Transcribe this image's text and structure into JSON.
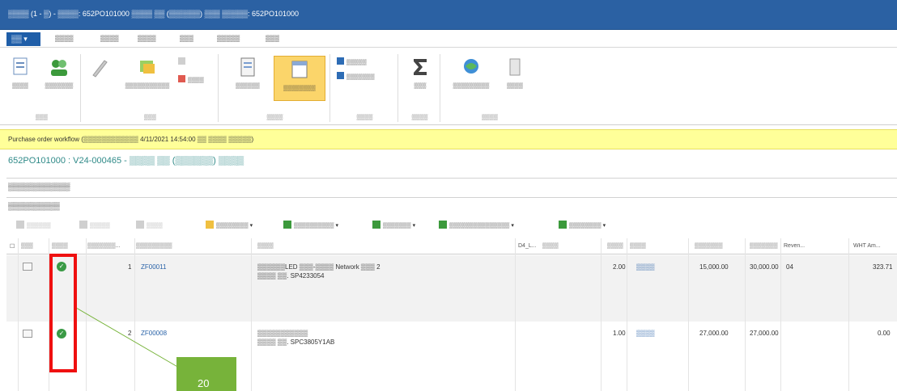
{
  "window": {
    "title": "▒▒▒▒ (1 - ▒) - ▒▒▒▒: 652PO101000 ▒▒▒▒ ▒▒ (▒▒▒▒▒▒) ▒▒▒ ▒▒▒▒▒: 652PO101000"
  },
  "ribbon_tabs": {
    "file": "▒▒ ▾",
    "tabs": [
      "▒▒▒▒",
      "▒▒▒▒",
      "▒▒▒▒",
      "▒▒▒",
      "▒▒▒▒▒",
      "▒▒▒"
    ]
  },
  "ribbon": {
    "new_group": {
      "label": "▒▒▒",
      "b1": "▒▒▒▒",
      "b2": "▒▒▒▒▒▒▒"
    },
    "maintain_group": {
      "label": "▒▒▒",
      "b1": "▒▒▒▒▒▒▒▒▒▒▒",
      "b2": "▒▒▒▒"
    },
    "view_group": {
      "label": "▒▒▒▒",
      "b1": "▒▒▒▒▒▒",
      "b2": "▒▒▒▒▒▒▒▒"
    },
    "related_group": {
      "label": "▒▒▒▒",
      "s1": "▒▒▒▒▒",
      "s2": "▒▒▒▒▒▒▒"
    },
    "totals_group": {
      "label": "▒▒▒▒",
      "b1": "▒▒▒"
    },
    "setup_group": {
      "label": "▒▒▒▒",
      "b1": "▒▒▒▒▒▒▒▒▒",
      "b2": "▒▒▒▒"
    },
    "icon_colors": {
      "green": "#3c9a3c",
      "blue": "#2d6cb5",
      "orange": "#e69a2e",
      "highlight": "#fbd56a"
    }
  },
  "workflow": {
    "text": "Purchase order workflow (▒▒▒▒▒▒▒▒▒▒▒▒ 4/11/2021 14:54:00 ▒▒ ▒▒▒▒ ▒▒▒▒▒)"
  },
  "subtitle": "652PO101000 : V24-000465 - ▒▒▒▒ ▒▒ (▒▒▒▒▒▒) ▒▒▒▒",
  "sections": {
    "header_fasttab": "▒▒▒▒▒▒▒▒▒▒▒▒",
    "lines_fasttab": "▒▒▒▒▒▒▒▒▒▒"
  },
  "grid_toolbar": [
    "▒▒▒▒▒▒",
    "▒▒▒▒▒",
    "▒▒▒▒",
    "▒▒▒▒▒▒▒▒ ▾",
    "▒▒▒▒▒▒▒▒▒▒ ▾",
    "▒▒▒▒▒▒▒ ▾",
    "▒▒▒▒▒▒▒▒▒▒▒▒▒▒▒ ▾",
    "▒▒▒▒▒▒▒▒ ▾"
  ],
  "grid": {
    "headers": {
      "type": "▒▒▒",
      "status": "▒▒▒▒",
      "line_no": "▒▒▒▒▒▒▒...",
      "item_no": "▒▒▒▒▒▒▒▒▒",
      "name": "▒▒▒▒",
      "dim": "D4_L...",
      "dim2": "▒▒▒▒",
      "qty": "▒▒▒▒",
      "unit": "▒▒▒▒",
      "price": "▒▒▒▒▒▒▒",
      "amount": "▒▒▒▒▒▒▒",
      "revenue": "Reven...",
      "wht": "WHT Am..."
    },
    "rows": [
      {
        "line": "1",
        "item": "ZF00011",
        "name1": "▒▒▒▒▒▒LED ▒▒▒-▒▒▒▒ Network ▒▒▒ 2",
        "name2": "▒▒▒▒ ▒▒. SP4233054",
        "qty": "2.00",
        "unit": "▒▒▒▒",
        "price": "15,000.00",
        "amount": "30,000.00",
        "revenue": "04",
        "wht": "323.71"
      },
      {
        "line": "2",
        "item": "ZF00008",
        "name1": "▒▒▒▒▒▒▒▒▒▒▒",
        "name2": "▒▒▒▒ ▒▒. SPC3805Y1AB",
        "qty": "1.00",
        "unit": "▒▒▒▒",
        "price": "27,000.00",
        "amount": "27,000.00",
        "revenue": "",
        "wht": "0.00"
      }
    ]
  },
  "annotation": {
    "number": "20",
    "box_color": "#ef1010",
    "tag_color": "#77b33a"
  }
}
